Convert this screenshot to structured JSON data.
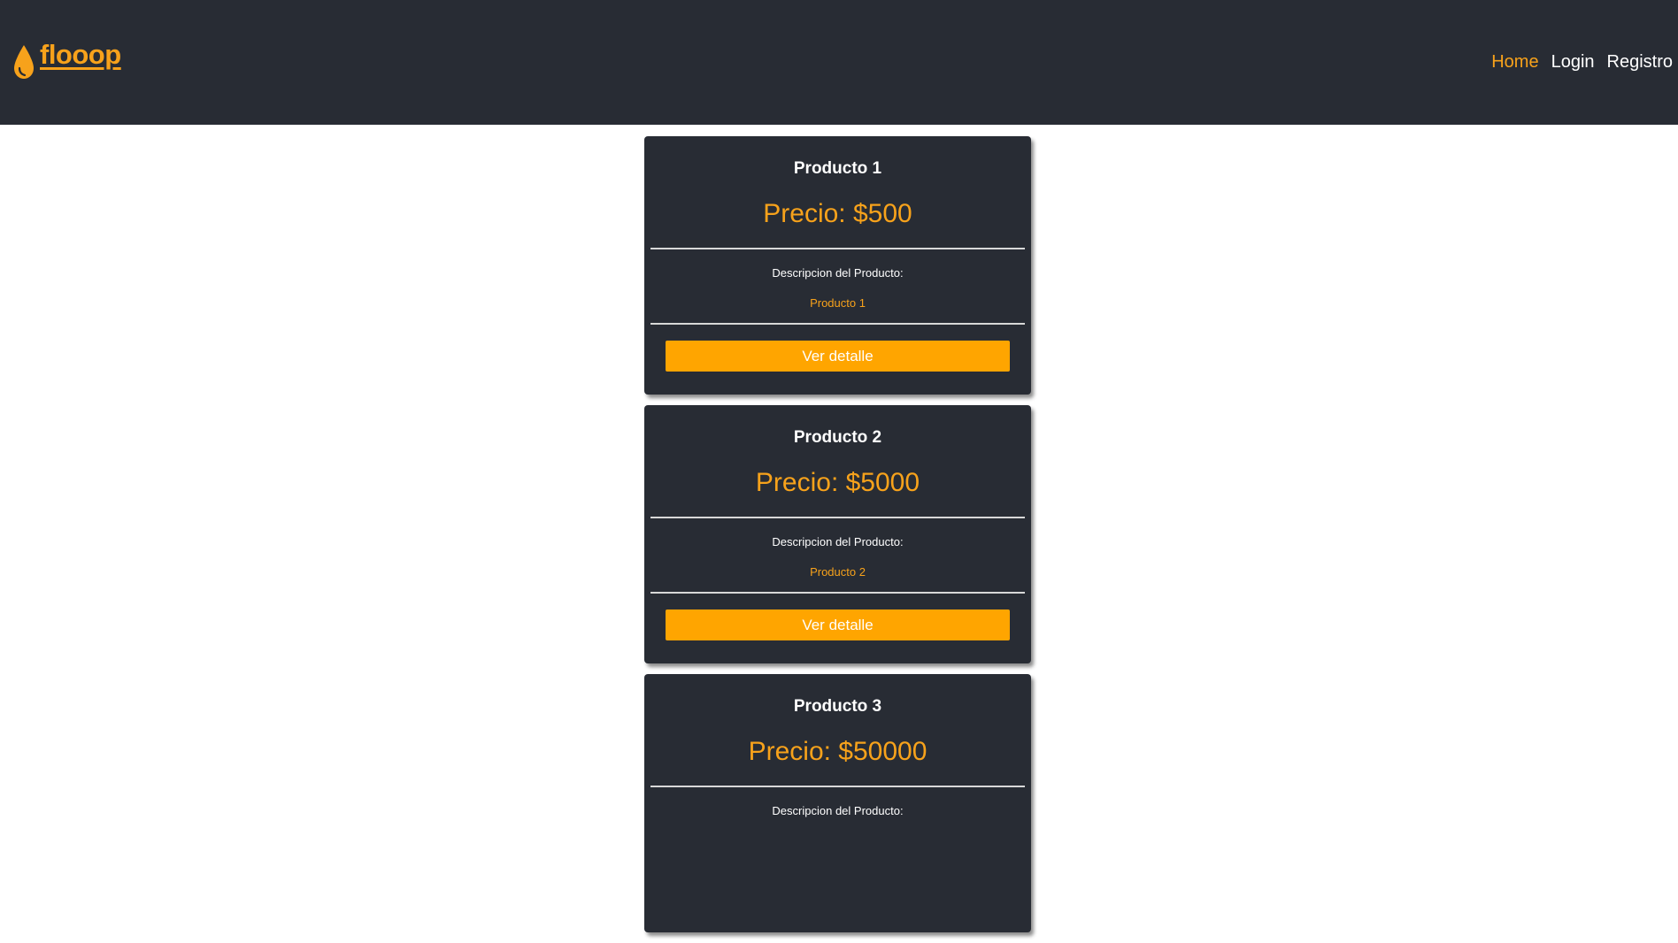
{
  "brand": {
    "name": "flooop",
    "icon": "water-drop-icon",
    "color": "#f7a21b"
  },
  "nav": {
    "items": [
      {
        "label": "Home",
        "active": true
      },
      {
        "label": "Login",
        "active": false
      },
      {
        "label": "Registro",
        "active": false
      }
    ]
  },
  "colors": {
    "navbar_bg": "#282c34",
    "card_bg": "#282c34",
    "accent": "#f7a21b",
    "button_bg": "#ffa500"
  },
  "products": [
    {
      "title": "Producto 1",
      "price": "Precio: $500",
      "desc_label": "Descripcion del Producto:",
      "desc_value": "Producto 1",
      "button_label": "Ver detalle"
    },
    {
      "title": "Producto 2",
      "price": "Precio: $5000",
      "desc_label": "Descripcion del Producto:",
      "desc_value": "Producto 2",
      "button_label": "Ver detalle"
    },
    {
      "title": "Producto 3",
      "price": "Precio: $50000",
      "desc_label": "Descripcion del Producto:"
    }
  ]
}
